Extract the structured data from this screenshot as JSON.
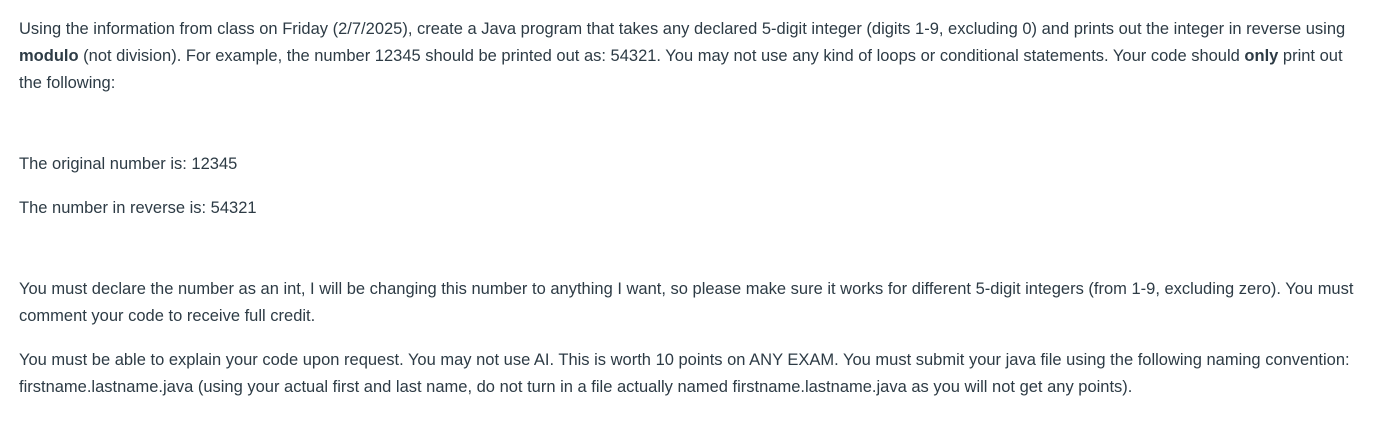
{
  "assignment": {
    "para1": {
      "part1": "Using the information from class on Friday (2/7/2025), create a Java program that takes any declared 5-digit integer (digits 1-9, excluding 0) and prints out the integer in reverse using ",
      "bold1": "modulo",
      "part2": " (not division). For example, the number 12345 should be printed out as: 54321. You may not use any kind of loops or conditional statements. Your code should ",
      "bold2": "only",
      "part3": " print out the following:"
    },
    "output_line1": "The original number is: 12345",
    "output_line2": "The number in reverse is: 54321",
    "para2": "You must declare the number as an int, I will be changing this number to anything I want, so please make sure it works for different 5-digit integers (from 1-9, excluding zero).  You must comment your code to receive full credit.",
    "para3": "You must be able to explain your code upon request. You may not use AI. This is worth 10 points on ANY EXAM. You must submit your java file using the following naming convention: firstname.lastname.java (using your actual first and last name, do not turn in a file actually named firstname.lastname.java as you will not get any points)."
  }
}
